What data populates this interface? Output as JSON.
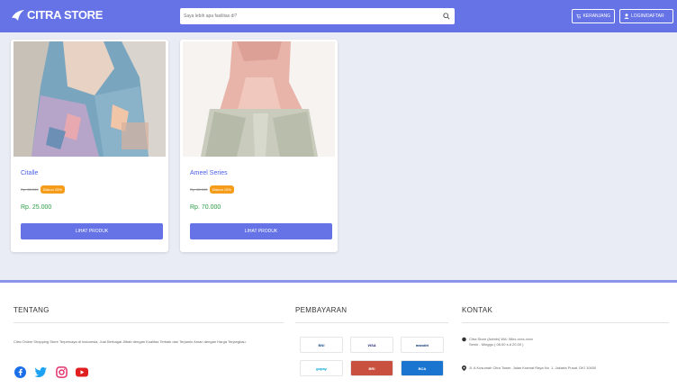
{
  "brand": {
    "name": "CITRA STORE"
  },
  "search": {
    "placeholder": "Saya lebih apa fasilitas di?"
  },
  "nav": {
    "cart_label": "KERANJANG",
    "login_label": "LOGIN/DAFTAR"
  },
  "products": [
    {
      "name": "Citalle",
      "old_price": "Rp. 65.000",
      "badge": "Diskon 25%",
      "price": "Rp. 25.000",
      "button": "LIHAT PRODUK"
    },
    {
      "name": "Ameel Series",
      "old_price": "Rp. 60.000",
      "badge": "Diskon 15%",
      "price": "Rp. 70.000",
      "button": "LIHAT PRODUK"
    }
  ],
  "footer": {
    "about_title": "TENTANG",
    "about_text": "Citra Online Shopping Store Terpercaya di Indonesia, Jual Berbagai Jilbab dengan Kualitas Terbaik dan Terjamin Aman dengan Harga Terjangkau.",
    "payment_title": "PEMBAYARAN",
    "payments": [
      "BNI",
      "VISA",
      "mandiri",
      "gopay",
      "BRI",
      "BCA"
    ],
    "contact_title": "KONTAK",
    "contact_phone": "Citra Store (Admin) WA: 08xx-xxxx-xxxx",
    "contact_hours": "Senin - Minggu ( 08.00 s.d 20.00 )",
    "contact_address": "Jl. A Kusumah Citra Tower, Jalan Kramat Raya No. 1, Jakarta Pusat, DKI 10450"
  },
  "colors": {
    "primary": "#6673e6",
    "badge": "#f59c1a",
    "price": "#2a9d47",
    "link": "#4a5ee8"
  }
}
